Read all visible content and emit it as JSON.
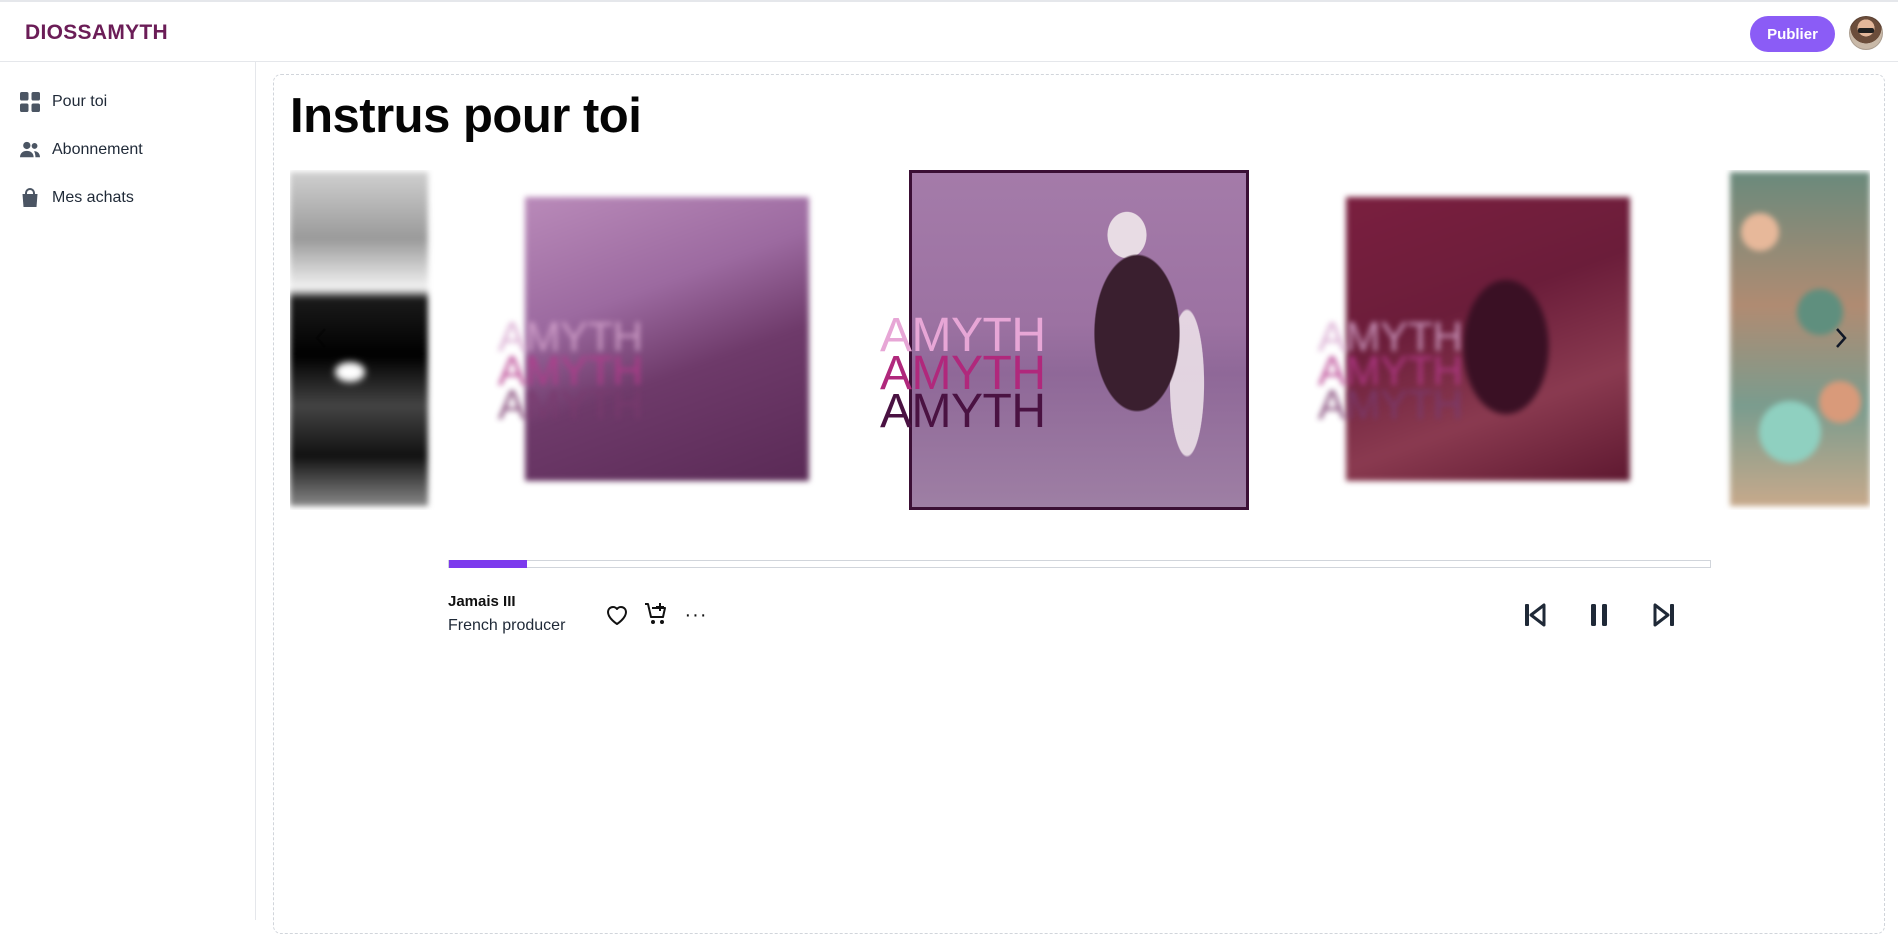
{
  "header": {
    "brand": "DIOSSAMYTH",
    "publish_label": "Publier",
    "avatar_icon": "user-avatar"
  },
  "sidebar": {
    "items": [
      {
        "label": "Pour toi",
        "icon": "grid-icon"
      },
      {
        "label": "Abonnement",
        "icon": "users-icon"
      },
      {
        "label": "Mes achats",
        "icon": "shopping-bag-icon"
      }
    ]
  },
  "main": {
    "title": "Instrus pour toi",
    "carousel": {
      "watermark": "AMYTH"
    }
  },
  "player": {
    "progress": 0.062,
    "title": "Jamais III",
    "artist": "French producer",
    "more_label": "···",
    "accent_color": "#7c3aed"
  },
  "colors": {
    "brand": "#6b1d57",
    "button": "#8b5cf6"
  }
}
